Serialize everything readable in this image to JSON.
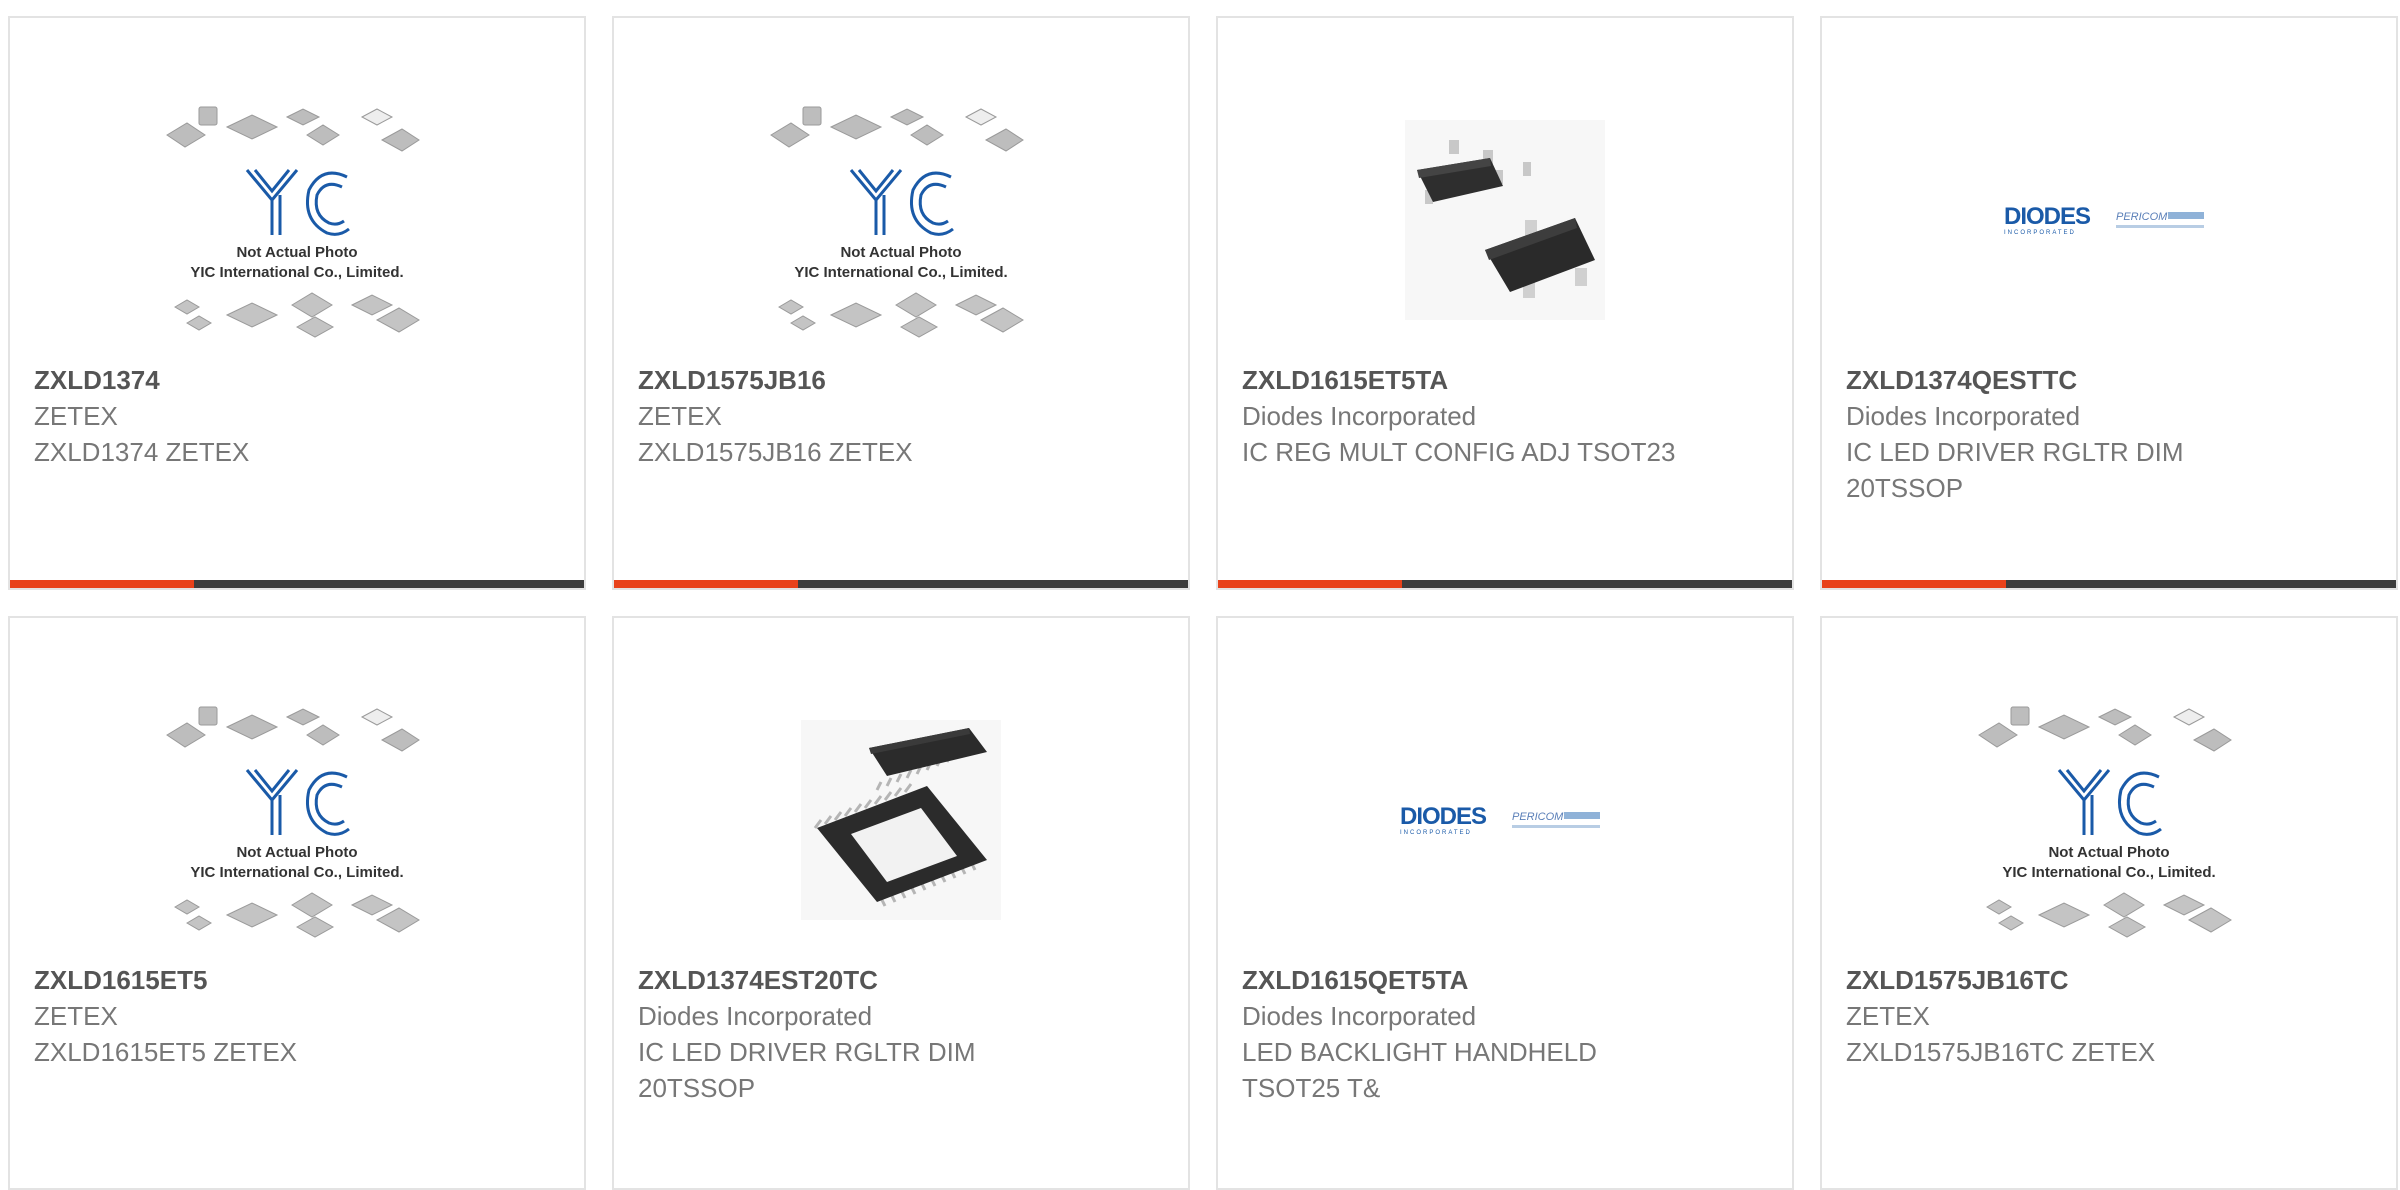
{
  "placeholder_image": {
    "line1": "Not Actual Photo",
    "line2": "YIC International Co., Limited.",
    "logo_text": "YIC"
  },
  "diodes_logo": {
    "brand": "DIODES",
    "tagline": "INCORPORATED",
    "sub_brand": "PERICOM"
  },
  "theme": {
    "accent": "#e8421b",
    "bar": "#3d3d3d",
    "logo_blue": "#1a5aa8"
  },
  "products": [
    {
      "part_number": "ZXLD1374",
      "manufacturer": "ZETEX",
      "description": "ZXLD1374 ZETEX",
      "image": "yic-placeholder-image"
    },
    {
      "part_number": "ZXLD1575JB16",
      "manufacturer": "ZETEX",
      "description": "ZXLD1575JB16 ZETEX",
      "image": "yic-placeholder-image"
    },
    {
      "part_number": "ZXLD1615ET5TA",
      "manufacturer": "Diodes Incorporated",
      "description": "IC REG MULT CONFIG ADJ TSOT23",
      "image": "sot23-chip-image"
    },
    {
      "part_number": "ZXLD1374QESTTC",
      "manufacturer": "Diodes Incorporated",
      "description": "IC LED DRIVER RGLTR DIM 20TSSOP",
      "image": "diodes-logo-image"
    },
    {
      "part_number": "ZXLD1615ET5",
      "manufacturer": "ZETEX",
      "description": "ZXLD1615ET5 ZETEX",
      "image": "yic-placeholder-image"
    },
    {
      "part_number": "ZXLD1374EST20TC",
      "manufacturer": "Diodes Incorporated",
      "description": "IC LED DRIVER RGLTR DIM 20TSSOP",
      "image": "tssop-chip-image"
    },
    {
      "part_number": "ZXLD1615QET5TA",
      "manufacturer": "Diodes Incorporated",
      "description": "LED BACKLIGHT HANDHELD TSOT25 T&",
      "image": "diodes-logo-image"
    },
    {
      "part_number": "ZXLD1575JB16TC",
      "manufacturer": "ZETEX",
      "description": "ZXLD1575JB16TC ZETEX",
      "image": "yic-placeholder-image"
    }
  ]
}
